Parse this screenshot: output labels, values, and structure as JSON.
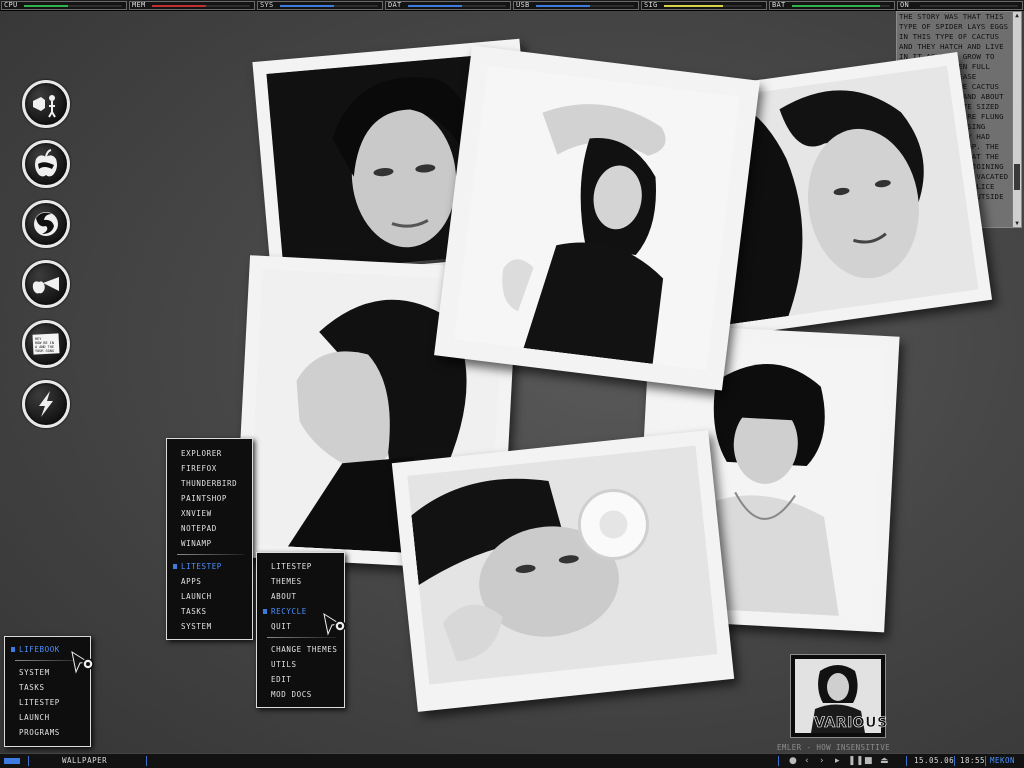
{
  "accent_color": "#3d7be0",
  "top_meters": [
    {
      "label": "CPU",
      "fill_fraction": 0.45,
      "color": "#2fb34a"
    },
    {
      "label": "MEM",
      "fill_fraction": 0.55,
      "color": "#c03030"
    },
    {
      "label": "SYS",
      "fill_fraction": 0.55,
      "color": "#3d7be0"
    },
    {
      "label": "DAT",
      "fill_fraction": 0.55,
      "color": "#3d7be0"
    },
    {
      "label": "USB",
      "fill_fraction": 0.55,
      "color": "#3d7be0"
    },
    {
      "label": "SIG",
      "fill_fraction": 0.6,
      "color": "#d8d34a"
    },
    {
      "label": "BAT",
      "fill_fraction": 0.9,
      "color": "#2fb34a"
    },
    {
      "label": "ON",
      "fill_fraction": 0.0,
      "color": "#3d7be0"
    }
  ],
  "story_text": "THE STORY WAS THAT THIS TYPE OF SPIDER LAYS EGGS IN THIS TYPE OF CACTUS AND THEY HATCH AND LIVE IN IT AS THEY GROW TO FULL SIZE. WHEN FULL SIZE THEY RELEASE THEMSELVES. THE CACTUS JUST EXPLODES AND ABOUT 150 DINNER PLATE SIZED HAIRY SPIDERS ARE FLUNG FROM IT, DISPERSING EVERYWHERE. THEY HAD BEEN READY TO POP. THE AFTERMATH WAS THAT THE HOUSE AND THE ADJOINING HOUSES HAD TO BE VACATED AND FUMIGATED; POLICE TAPE WAS PUT UP OUTSIDE THE",
  "dock_icons": [
    "speaker-icon",
    "apple-icon",
    "firefox-icon",
    "apple-torch-icon",
    "note-icon",
    "lightning-icon"
  ],
  "dock_note_text": "HEY HOW BE IN A AND THE AND YOUR SONG",
  "life_menu": {
    "items": [
      "LIFEBOOK",
      "SYSTEM",
      "TASKS",
      "LITESTEP",
      "LAUNCH",
      "PROGRAMS"
    ],
    "active": "LIFEBOOK"
  },
  "programs_menu": {
    "items_top": [
      "EXPLORER",
      "FIREFOX",
      "THUNDERBIRD",
      "PAINTSHOP",
      "XNVIEW",
      "NOTEPAD",
      "WINAMP"
    ],
    "items_bottom": [
      "LITESTEP",
      "APPS",
      "LAUNCH",
      "TASKS",
      "SYSTEM"
    ],
    "active": "LITESTEP"
  },
  "litestep_menu": {
    "items_top": [
      "LITESTEP",
      "THEMES",
      "ABOUT",
      "RECYCLE",
      "QUIT"
    ],
    "items_bottom": [
      "CHANGE THEMES",
      "UTILS",
      "EDIT",
      "MOD DOCS"
    ],
    "active": "RECYCLE"
  },
  "album": {
    "title": "VARIOUS",
    "now_playing": "EMLER - HOW INSENSITIVE"
  },
  "taskbar": {
    "task": "WALLPAPER",
    "controls": [
      "●",
      "‹",
      "›",
      "▸",
      "❚❚",
      "■",
      "⏏"
    ],
    "date": "15.05.06",
    "time": "18:55",
    "user": "MEKON"
  }
}
